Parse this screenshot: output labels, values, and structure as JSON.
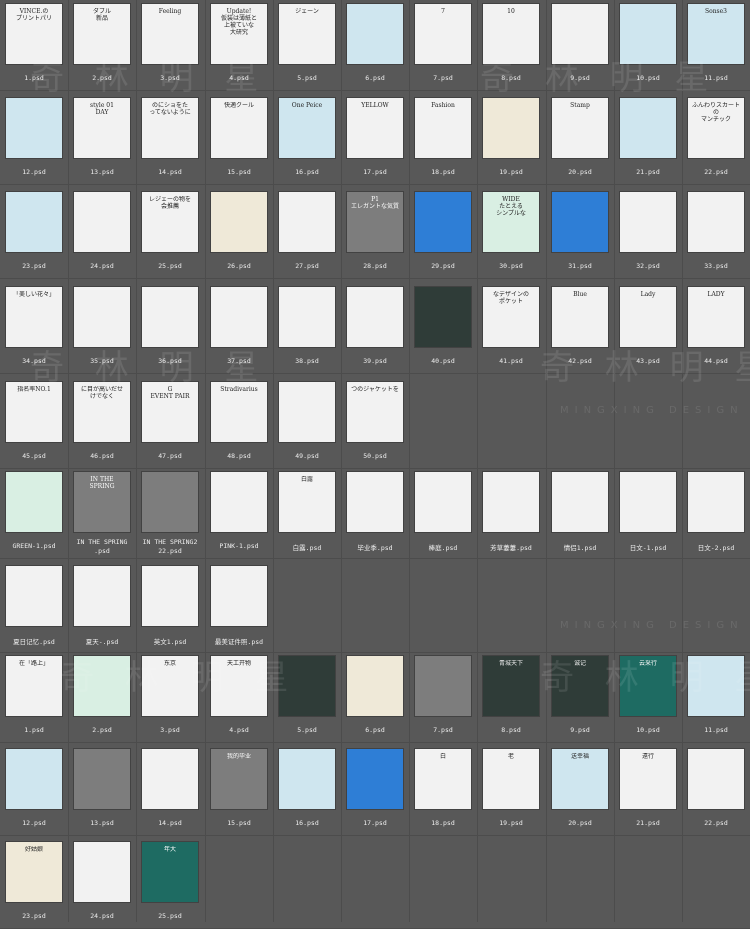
{
  "sections": [
    {
      "id": "group-a",
      "items": [
        {
          "label": "1.psd",
          "text": "VINCE.の\nプリントパリ",
          "style": "none"
        },
        {
          "label": "2.psd",
          "text": "ダブル \n新品",
          "style": "none"
        },
        {
          "label": "3.psd",
          "text": "Feeling",
          "style": "none"
        },
        {
          "label": "4.psd",
          "text": "Update!\n仮装は薄紙と\n上被ていな\n大研究",
          "style": "none"
        },
        {
          "label": "5.psd",
          "text": "ジェーン",
          "style": "none"
        },
        {
          "label": "6.psd",
          "text": "",
          "style": "lightblue"
        },
        {
          "label": "7.psd",
          "text": "7",
          "style": "none"
        },
        {
          "label": "8.psd",
          "text": "10",
          "style": "none"
        },
        {
          "label": "9.psd",
          "text": "",
          "style": "none"
        },
        {
          "label": "10.psd",
          "text": "",
          "style": "lightblue"
        },
        {
          "label": "11.psd",
          "text": "Sonse3",
          "style": "lightblue"
        },
        {
          "label": "12.psd",
          "text": "",
          "style": "lightblue"
        },
        {
          "label": "13.psd",
          "text": "style 01\nDAY",
          "style": "none"
        },
        {
          "label": "14.psd",
          "text": "のにショをた\nってないように",
          "style": "none"
        },
        {
          "label": "15.psd",
          "text": "快適クール",
          "style": "none"
        },
        {
          "label": "16.psd",
          "text": "One Peice",
          "style": "lightblue"
        },
        {
          "label": "17.psd",
          "text": "YELLOW",
          "style": "none"
        },
        {
          "label": "18.psd",
          "text": "Fashion",
          "style": "none"
        },
        {
          "label": "19.psd",
          "text": "",
          "style": "cream"
        },
        {
          "label": "20.psd",
          "text": "Stamp",
          "style": "none"
        },
        {
          "label": "21.psd",
          "text": "",
          "style": "lightblue"
        },
        {
          "label": "22.psd",
          "text": "ふんわりスカートの\nマンチック",
          "style": "none"
        },
        {
          "label": "23.psd",
          "text": "",
          "style": "lightblue"
        },
        {
          "label": "24.psd",
          "text": "",
          "style": "none"
        },
        {
          "label": "25.psd",
          "text": "レジェーの物を\n会推薦",
          "style": "none"
        },
        {
          "label": "26.psd",
          "text": "",
          "style": "cream"
        },
        {
          "label": "27.psd",
          "text": "",
          "style": "none"
        },
        {
          "label": "28.psd",
          "text": "P1\nエレガントな気質",
          "style": "gray"
        },
        {
          "label": "29.psd",
          "text": "",
          "style": "blue"
        },
        {
          "label": "30.psd",
          "text": "WIDE\nたとえる\nシンプルな",
          "style": "mint"
        },
        {
          "label": "31.psd",
          "text": "",
          "style": "blue"
        },
        {
          "label": "32.psd",
          "text": "",
          "style": "none"
        },
        {
          "label": "33.psd",
          "text": "",
          "style": "none"
        },
        {
          "label": "34.psd",
          "text": "「美しい花々」",
          "style": "none"
        },
        {
          "label": "35.psd",
          "text": "",
          "style": "none"
        },
        {
          "label": "36.psd",
          "text": "",
          "style": "none"
        },
        {
          "label": "37.psd",
          "text": "",
          "style": "none"
        },
        {
          "label": "38.psd",
          "text": "",
          "style": "none"
        },
        {
          "label": "39.psd",
          "text": "",
          "style": "none"
        },
        {
          "label": "40.psd",
          "text": "",
          "style": "dark"
        },
        {
          "label": "41.psd",
          "text": "なデザインの\nポケット",
          "style": "none"
        },
        {
          "label": "42.psd",
          "text": "Blue",
          "style": "none"
        },
        {
          "label": "43.psd",
          "text": "Lady",
          "style": "none"
        },
        {
          "label": "44.psd",
          "text": "LADY",
          "style": "none"
        },
        {
          "label": "45.psd",
          "text": "指名率NO.1",
          "style": "none"
        },
        {
          "label": "46.psd",
          "text": "に目が高いだせ\nけでなく",
          "style": "none"
        },
        {
          "label": "47.psd",
          "text": "G\nEVENT PAIR",
          "style": "none"
        },
        {
          "label": "48.psd",
          "text": "Stradivarius",
          "style": "none"
        },
        {
          "label": "49.psd",
          "text": "",
          "style": "none"
        },
        {
          "label": "50.psd",
          "text": "つのジャケットを",
          "style": "none"
        }
      ]
    },
    {
      "id": "group-b",
      "items": [
        {
          "label": "GREEN-1.psd",
          "text": "",
          "style": "mint"
        },
        {
          "label": "IN THE SPRING\n.psd",
          "text": "IN THE SPRING",
          "style": "gray"
        },
        {
          "label": "IN THE SPRING2\n22.psd",
          "text": "",
          "style": "gray"
        },
        {
          "label": "PINK-1.psd",
          "text": "",
          "style": "none"
        },
        {
          "label": "白露.psd",
          "text": "白露",
          "style": "none"
        },
        {
          "label": "毕业季.psd",
          "text": "",
          "style": "none"
        },
        {
          "label": "棒庭.psd",
          "text": "",
          "style": "none"
        },
        {
          "label": "芳草萋萋.psd",
          "text": "",
          "style": "none"
        },
        {
          "label": "情侣1.psd",
          "text": "",
          "style": "none"
        },
        {
          "label": "日文-1.psd",
          "text": "",
          "style": "none"
        },
        {
          "label": "日文-2.psd",
          "text": "",
          "style": "none"
        },
        {
          "label": "夏日记忆.psd",
          "text": "",
          "style": "none"
        },
        {
          "label": "夏天-.psd",
          "text": "",
          "style": "none"
        },
        {
          "label": "英文1.psd",
          "text": "",
          "style": "none"
        },
        {
          "label": "最美证件照.psd",
          "text": "",
          "style": "none"
        }
      ]
    },
    {
      "id": "group-c",
      "items": [
        {
          "label": "1.psd",
          "text": "在「路上」",
          "style": "none"
        },
        {
          "label": "2.psd",
          "text": "",
          "style": "mint"
        },
        {
          "label": "3.psd",
          "text": "东京",
          "style": "none"
        },
        {
          "label": "4.psd",
          "text": "天工开物",
          "style": "none"
        },
        {
          "label": "5.psd",
          "text": "",
          "style": "dark"
        },
        {
          "label": "6.psd",
          "text": "",
          "style": "cream"
        },
        {
          "label": "7.psd",
          "text": "",
          "style": "gray"
        },
        {
          "label": "8.psd",
          "text": "青城天下",
          "style": "dark"
        },
        {
          "label": "9.psd",
          "text": "诚记",
          "style": "dark"
        },
        {
          "label": "10.psd",
          "text": "云采行",
          "style": "teal"
        },
        {
          "label": "11.psd",
          "text": "",
          "style": "lightblue"
        },
        {
          "label": "12.psd",
          "text": "",
          "style": "lightblue"
        },
        {
          "label": "13.psd",
          "text": "",
          "style": "gray"
        },
        {
          "label": "14.psd",
          "text": "",
          "style": "none"
        },
        {
          "label": "15.psd",
          "text": "我的毕业",
          "style": "gray"
        },
        {
          "label": "16.psd",
          "text": "",
          "style": "lightblue"
        },
        {
          "label": "17.psd",
          "text": "",
          "style": "blue"
        },
        {
          "label": "18.psd",
          "text": "白",
          "style": "none"
        },
        {
          "label": "19.psd",
          "text": "老",
          "style": "none"
        },
        {
          "label": "20.psd",
          "text": "送幸福",
          "style": "lightblue"
        },
        {
          "label": "21.psd",
          "text": "遠行",
          "style": "none"
        },
        {
          "label": "22.psd",
          "text": "",
          "style": "none"
        },
        {
          "label": "23.psd",
          "text": "好姑娘",
          "style": "cream"
        },
        {
          "label": "24.psd",
          "text": "",
          "style": "none"
        },
        {
          "label": "25.psd",
          "text": "年大",
          "style": "teal"
        }
      ]
    }
  ],
  "watermarks": [
    "奇 林 明 星",
    "MINGXING DESIGN"
  ]
}
